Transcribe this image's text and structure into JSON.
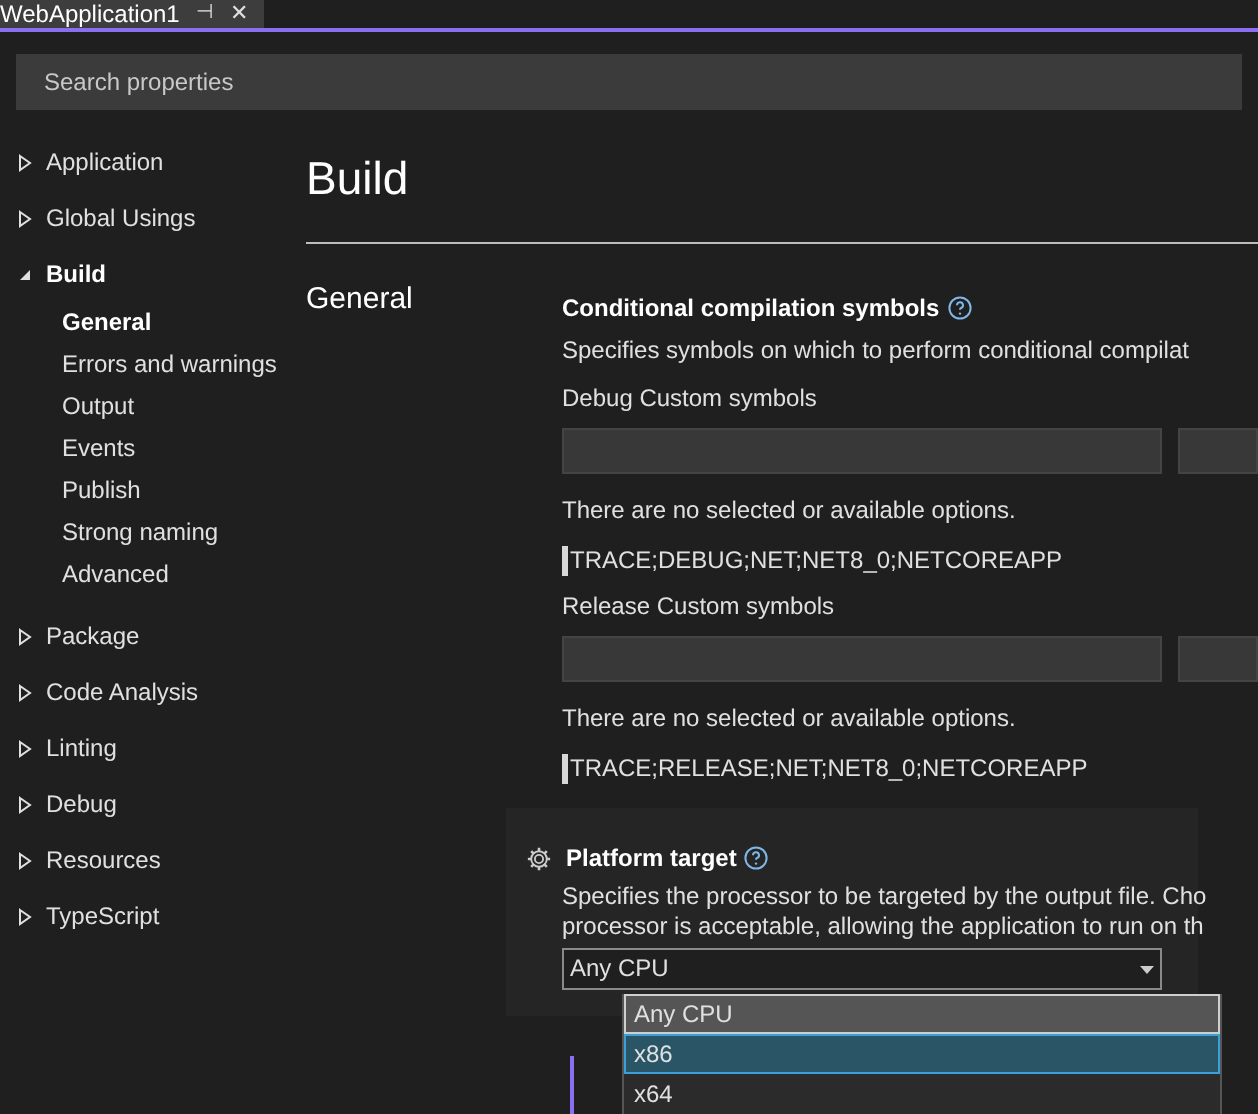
{
  "document_tab": {
    "title": "WebApplication1",
    "pin": "⊣",
    "close": "✕"
  },
  "search": {
    "placeholder": "Search properties"
  },
  "sidebar": {
    "items": [
      {
        "label": "Application",
        "expanded": false
      },
      {
        "label": "Global Usings",
        "expanded": false
      },
      {
        "label": "Build",
        "expanded": true,
        "children": [
          {
            "label": "General",
            "selected": true
          },
          {
            "label": "Errors and warnings",
            "selected": false
          },
          {
            "label": "Output",
            "selected": false
          },
          {
            "label": "Events",
            "selected": false
          },
          {
            "label": "Publish",
            "selected": false
          },
          {
            "label": "Strong naming",
            "selected": false
          },
          {
            "label": "Advanced",
            "selected": false
          }
        ]
      },
      {
        "label": "Package",
        "expanded": false
      },
      {
        "label": "Code Analysis",
        "expanded": false
      },
      {
        "label": "Linting",
        "expanded": false
      },
      {
        "label": "Debug",
        "expanded": false
      },
      {
        "label": "Resources",
        "expanded": false
      },
      {
        "label": "TypeScript",
        "expanded": false
      }
    ]
  },
  "page": {
    "title": "Build",
    "section": "General"
  },
  "symbols": {
    "title": "Conditional compilation symbols",
    "description": "Specifies symbols on which to perform conditional compilat",
    "groups": [
      {
        "label": "Debug Custom symbols",
        "empty_message": "There are no selected or available options.",
        "defined_symbols": "TRACE;DEBUG;NET;NET8_0;NETCOREAPP"
      },
      {
        "label": "Release Custom symbols",
        "empty_message": "There are no selected or available options.",
        "defined_symbols": "TRACE;RELEASE;NET;NET8_0;NETCOREAPP"
      }
    ]
  },
  "platform": {
    "title": "Platform target",
    "description_lines": [
      "Specifies the processor to be targeted by the output file. Cho",
      "processor is acceptable, allowing the application to run on th"
    ],
    "value": "Any CPU",
    "options": [
      {
        "label": "Any CPU",
        "selected": true,
        "hovered": false
      },
      {
        "label": "x86",
        "selected": false,
        "hovered": true
      },
      {
        "label": "x64",
        "selected": false,
        "hovered": false
      }
    ]
  }
}
